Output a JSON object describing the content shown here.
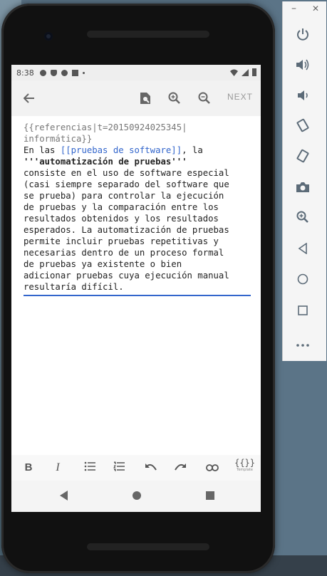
{
  "statusbar": {
    "time": "8:38"
  },
  "toolbar": {
    "next_label": "NEXT"
  },
  "editor": {
    "lines": [
      "{{referencias|t=20150924025345|",
      "informática}}",
      "En las ",
      "[[pruebas de software]]",
      ", la",
      "'''automatización de pruebas'''",
      "consiste en el uso de software especial",
      "(casi siempre separado del software que",
      "se prueba) para controlar la ejecución",
      "de pruebas y la comparación entre los",
      "resultados obtenidos y los resultados",
      "esperados. La automatización de pruebas",
      "permite incluir pruebas repetitivas y",
      "necesarias dentro de un proceso formal",
      "de pruebas ya existente o bien",
      "adicionar pruebas cuya ejecución manual",
      "resultaría difícil."
    ]
  },
  "format_bar": {
    "bold": "B",
    "italic": "I",
    "template_braces": "{{}}",
    "template_label": "Template"
  },
  "colors": {
    "link": "#3366cc",
    "accent": "#3366cc",
    "panel_icon": "#5c6b78"
  }
}
